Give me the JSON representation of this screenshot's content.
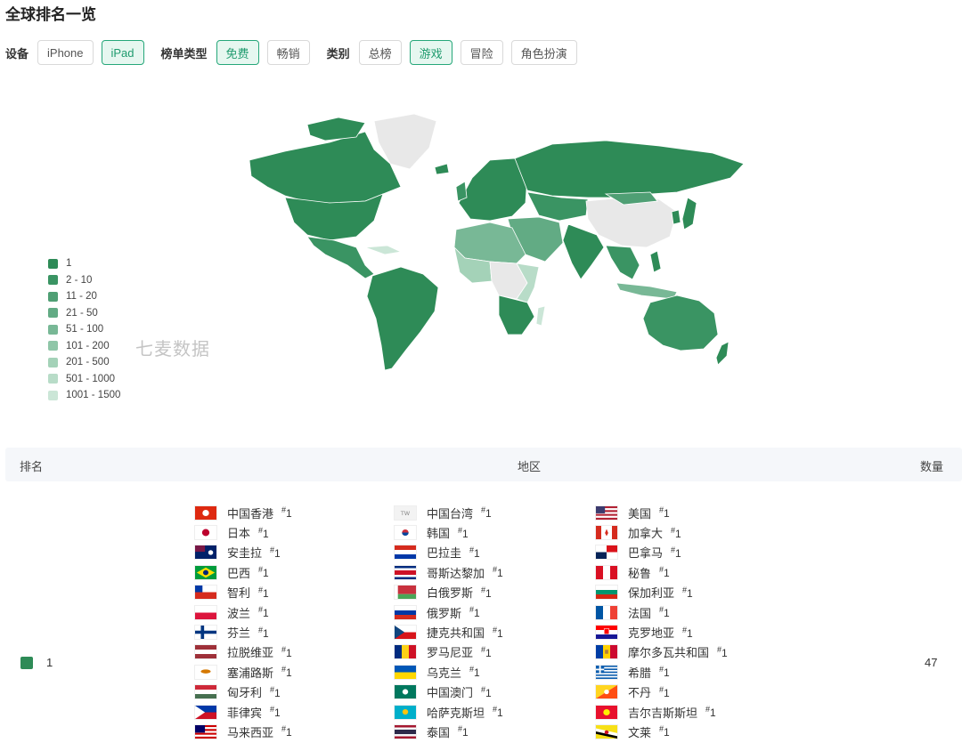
{
  "page_title": "全球排名一览",
  "filters": {
    "device": {
      "label": "设备",
      "options": [
        "iPhone",
        "iPad"
      ],
      "selected": "iPad"
    },
    "chart_type": {
      "label": "榜单类型",
      "options": [
        "免费",
        "畅销"
      ],
      "selected": "免费"
    },
    "category": {
      "label": "类别",
      "options": [
        "总榜",
        "游戏",
        "冒险",
        "角色扮演"
      ],
      "selected": "游戏"
    }
  },
  "legend": [
    {
      "label": "1",
      "color": "#2e8b57"
    },
    {
      "label": "2 - 10",
      "color": "#3a9463"
    },
    {
      "label": "11 - 20",
      "color": "#4f9f74"
    },
    {
      "label": "21 - 50",
      "color": "#62ab84"
    },
    {
      "label": "51 - 100",
      "color": "#78b896"
    },
    {
      "label": "101 - 200",
      "color": "#8fc6a8"
    },
    {
      "label": "201 - 500",
      "color": "#a4d2b8"
    },
    {
      "label": "501 - 1000",
      "color": "#b8dcc8"
    },
    {
      "label": "1001 - 1500",
      "color": "#cbe6d7"
    }
  ],
  "watermark": "七麦数据",
  "table": {
    "headers": {
      "rank": "排名",
      "region": "地区",
      "count": "数量"
    },
    "rows": [
      {
        "rank_label": "1",
        "count": "47",
        "countries": [
          [
            {
              "name": "中国香港",
              "rank": "1",
              "flag": "hk"
            },
            {
              "name": "日本",
              "rank": "1",
              "flag": "jp"
            },
            {
              "name": "安圭拉",
              "rank": "1",
              "flag": "ai"
            },
            {
              "name": "巴西",
              "rank": "1",
              "flag": "br"
            },
            {
              "name": "智利",
              "rank": "1",
              "flag": "cl"
            },
            {
              "name": "波兰",
              "rank": "1",
              "flag": "pl"
            },
            {
              "name": "芬兰",
              "rank": "1",
              "flag": "fi"
            },
            {
              "name": "拉脱维亚",
              "rank": "1",
              "flag": "lv"
            },
            {
              "name": "塞浦路斯",
              "rank": "1",
              "flag": "cy"
            },
            {
              "name": "匈牙利",
              "rank": "1",
              "flag": "hu"
            },
            {
              "name": "菲律宾",
              "rank": "1",
              "flag": "ph"
            },
            {
              "name": "马来西亚",
              "rank": "1",
              "flag": "my"
            }
          ],
          [
            {
              "name": "中国台湾",
              "rank": "1",
              "flag": "tw",
              "flag_text": "TW"
            },
            {
              "name": "韩国",
              "rank": "1",
              "flag": "kr"
            },
            {
              "name": "巴拉圭",
              "rank": "1",
              "flag": "py"
            },
            {
              "name": "哥斯达黎加",
              "rank": "1",
              "flag": "cr"
            },
            {
              "name": "白俄罗斯",
              "rank": "1",
              "flag": "by"
            },
            {
              "name": "俄罗斯",
              "rank": "1",
              "flag": "ru"
            },
            {
              "name": "捷克共和国",
              "rank": "1",
              "flag": "cz"
            },
            {
              "name": "罗马尼亚",
              "rank": "1",
              "flag": "ro"
            },
            {
              "name": "乌克兰",
              "rank": "1",
              "flag": "ua"
            },
            {
              "name": "中国澳门",
              "rank": "1",
              "flag": "mo"
            },
            {
              "name": "哈萨克斯坦",
              "rank": "1",
              "flag": "kz"
            },
            {
              "name": "泰国",
              "rank": "1",
              "flag": "th"
            }
          ],
          [
            {
              "name": "美国",
              "rank": "1",
              "flag": "us"
            },
            {
              "name": "加拿大",
              "rank": "1",
              "flag": "ca"
            },
            {
              "name": "巴拿马",
              "rank": "1",
              "flag": "pa"
            },
            {
              "name": "秘鲁",
              "rank": "1",
              "flag": "pe"
            },
            {
              "name": "保加利亚",
              "rank": "1",
              "flag": "bg"
            },
            {
              "name": "法国",
              "rank": "1",
              "flag": "fr"
            },
            {
              "name": "克罗地亚",
              "rank": "1",
              "flag": "hr"
            },
            {
              "name": "摩尔多瓦共和国",
              "rank": "1",
              "flag": "md"
            },
            {
              "name": "希腊",
              "rank": "1",
              "flag": "gr"
            },
            {
              "name": "不丹",
              "rank": "1",
              "flag": "bt"
            },
            {
              "name": "吉尔吉斯斯坦",
              "rank": "1",
              "flag": "kg"
            },
            {
              "name": "文莱",
              "rank": "1",
              "flag": "bn"
            }
          ]
        ]
      }
    ]
  }
}
